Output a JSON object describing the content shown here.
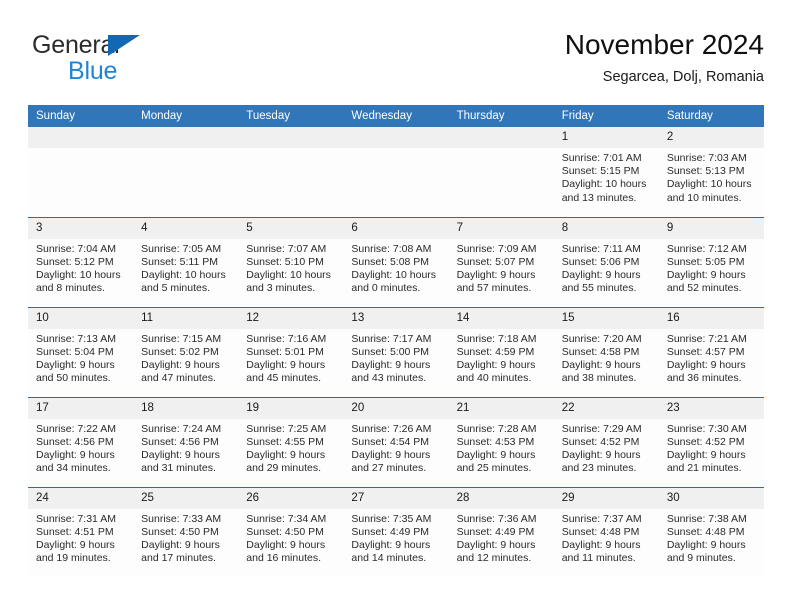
{
  "brand": {
    "line1": "General",
    "line2": "Blue",
    "triangle_color": "#1268b3",
    "line2_color": "#1f84d6"
  },
  "header": {
    "month_title": "November 2024",
    "location": "Segarcea, Dolj, Romania"
  },
  "theme": {
    "header_blue": "#3076b8",
    "row_border": "#2b6ca3",
    "daynum_bg": "#f0f0f0",
    "cell_bg": "#fdfdfd"
  },
  "weekdays": [
    "Sunday",
    "Monday",
    "Tuesday",
    "Wednesday",
    "Thursday",
    "Friday",
    "Saturday"
  ],
  "labels": {
    "sunrise": "Sunrise:",
    "sunset": "Sunset:",
    "daylight": "Daylight:"
  },
  "weeks": [
    [
      {
        "blank": true
      },
      {
        "blank": true
      },
      {
        "blank": true
      },
      {
        "blank": true
      },
      {
        "blank": true
      },
      {
        "day": "1",
        "sunrise": "Sunrise: 7:01 AM",
        "sunset": "Sunset: 5:15 PM",
        "daylight": "Daylight: 10 hours and 13 minutes."
      },
      {
        "day": "2",
        "sunrise": "Sunrise: 7:03 AM",
        "sunset": "Sunset: 5:13 PM",
        "daylight": "Daylight: 10 hours and 10 minutes."
      }
    ],
    [
      {
        "day": "3",
        "sunrise": "Sunrise: 7:04 AM",
        "sunset": "Sunset: 5:12 PM",
        "daylight": "Daylight: 10 hours and 8 minutes."
      },
      {
        "day": "4",
        "sunrise": "Sunrise: 7:05 AM",
        "sunset": "Sunset: 5:11 PM",
        "daylight": "Daylight: 10 hours and 5 minutes."
      },
      {
        "day": "5",
        "sunrise": "Sunrise: 7:07 AM",
        "sunset": "Sunset: 5:10 PM",
        "daylight": "Daylight: 10 hours and 3 minutes."
      },
      {
        "day": "6",
        "sunrise": "Sunrise: 7:08 AM",
        "sunset": "Sunset: 5:08 PM",
        "daylight": "Daylight: 10 hours and 0 minutes."
      },
      {
        "day": "7",
        "sunrise": "Sunrise: 7:09 AM",
        "sunset": "Sunset: 5:07 PM",
        "daylight": "Daylight: 9 hours and 57 minutes."
      },
      {
        "day": "8",
        "sunrise": "Sunrise: 7:11 AM",
        "sunset": "Sunset: 5:06 PM",
        "daylight": "Daylight: 9 hours and 55 minutes."
      },
      {
        "day": "9",
        "sunrise": "Sunrise: 7:12 AM",
        "sunset": "Sunset: 5:05 PM",
        "daylight": "Daylight: 9 hours and 52 minutes."
      }
    ],
    [
      {
        "day": "10",
        "sunrise": "Sunrise: 7:13 AM",
        "sunset": "Sunset: 5:04 PM",
        "daylight": "Daylight: 9 hours and 50 minutes."
      },
      {
        "day": "11",
        "sunrise": "Sunrise: 7:15 AM",
        "sunset": "Sunset: 5:02 PM",
        "daylight": "Daylight: 9 hours and 47 minutes."
      },
      {
        "day": "12",
        "sunrise": "Sunrise: 7:16 AM",
        "sunset": "Sunset: 5:01 PM",
        "daylight": "Daylight: 9 hours and 45 minutes."
      },
      {
        "day": "13",
        "sunrise": "Sunrise: 7:17 AM",
        "sunset": "Sunset: 5:00 PM",
        "daylight": "Daylight: 9 hours and 43 minutes."
      },
      {
        "day": "14",
        "sunrise": "Sunrise: 7:18 AM",
        "sunset": "Sunset: 4:59 PM",
        "daylight": "Daylight: 9 hours and 40 minutes."
      },
      {
        "day": "15",
        "sunrise": "Sunrise: 7:20 AM",
        "sunset": "Sunset: 4:58 PM",
        "daylight": "Daylight: 9 hours and 38 minutes."
      },
      {
        "day": "16",
        "sunrise": "Sunrise: 7:21 AM",
        "sunset": "Sunset: 4:57 PM",
        "daylight": "Daylight: 9 hours and 36 minutes."
      }
    ],
    [
      {
        "day": "17",
        "sunrise": "Sunrise: 7:22 AM",
        "sunset": "Sunset: 4:56 PM",
        "daylight": "Daylight: 9 hours and 34 minutes."
      },
      {
        "day": "18",
        "sunrise": "Sunrise: 7:24 AM",
        "sunset": "Sunset: 4:56 PM",
        "daylight": "Daylight: 9 hours and 31 minutes."
      },
      {
        "day": "19",
        "sunrise": "Sunrise: 7:25 AM",
        "sunset": "Sunset: 4:55 PM",
        "daylight": "Daylight: 9 hours and 29 minutes."
      },
      {
        "day": "20",
        "sunrise": "Sunrise: 7:26 AM",
        "sunset": "Sunset: 4:54 PM",
        "daylight": "Daylight: 9 hours and 27 minutes."
      },
      {
        "day": "21",
        "sunrise": "Sunrise: 7:28 AM",
        "sunset": "Sunset: 4:53 PM",
        "daylight": "Daylight: 9 hours and 25 minutes."
      },
      {
        "day": "22",
        "sunrise": "Sunrise: 7:29 AM",
        "sunset": "Sunset: 4:52 PM",
        "daylight": "Daylight: 9 hours and 23 minutes."
      },
      {
        "day": "23",
        "sunrise": "Sunrise: 7:30 AM",
        "sunset": "Sunset: 4:52 PM",
        "daylight": "Daylight: 9 hours and 21 minutes."
      }
    ],
    [
      {
        "day": "24",
        "sunrise": "Sunrise: 7:31 AM",
        "sunset": "Sunset: 4:51 PM",
        "daylight": "Daylight: 9 hours and 19 minutes."
      },
      {
        "day": "25",
        "sunrise": "Sunrise: 7:33 AM",
        "sunset": "Sunset: 4:50 PM",
        "daylight": "Daylight: 9 hours and 17 minutes."
      },
      {
        "day": "26",
        "sunrise": "Sunrise: 7:34 AM",
        "sunset": "Sunset: 4:50 PM",
        "daylight": "Daylight: 9 hours and 16 minutes."
      },
      {
        "day": "27",
        "sunrise": "Sunrise: 7:35 AM",
        "sunset": "Sunset: 4:49 PM",
        "daylight": "Daylight: 9 hours and 14 minutes."
      },
      {
        "day": "28",
        "sunrise": "Sunrise: 7:36 AM",
        "sunset": "Sunset: 4:49 PM",
        "daylight": "Daylight: 9 hours and 12 minutes."
      },
      {
        "day": "29",
        "sunrise": "Sunrise: 7:37 AM",
        "sunset": "Sunset: 4:48 PM",
        "daylight": "Daylight: 9 hours and 11 minutes."
      },
      {
        "day": "30",
        "sunrise": "Sunrise: 7:38 AM",
        "sunset": "Sunset: 4:48 PM",
        "daylight": "Daylight: 9 hours and 9 minutes."
      }
    ]
  ]
}
